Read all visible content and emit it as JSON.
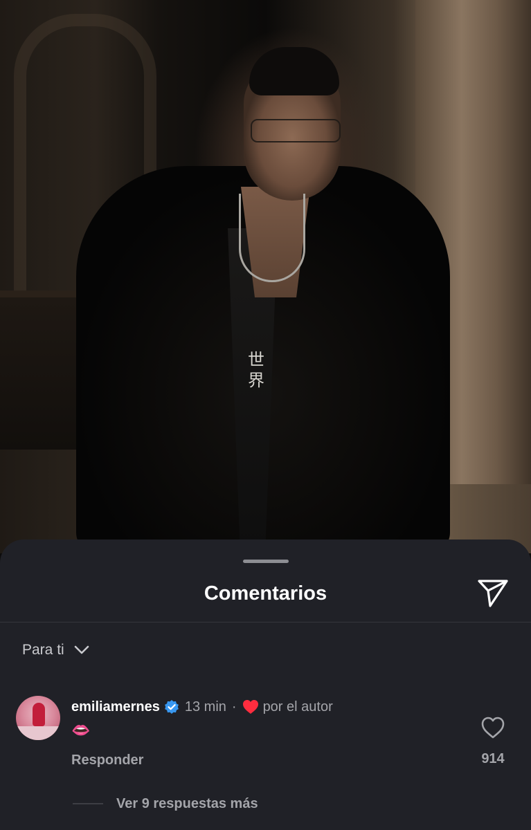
{
  "post": {
    "image": "photo of a man in a black fur coat inside a church",
    "shirt_glyphs": "世界",
    "colors": {
      "sheet_bg": "#202127",
      "muted_text": "#a4a5aa"
    }
  },
  "comments_sheet": {
    "title": "Comentarios",
    "share_icon": "paper-plane-icon",
    "filter": {
      "label": "Para ti",
      "icon": "chevron-down-icon"
    },
    "comments": [
      {
        "username": "emiliamernes",
        "verified": true,
        "time": "13 min",
        "separator": "·",
        "author_like_label": "por el autor",
        "author_like_icon": "red-heart-icon",
        "text": "👄",
        "reply_label": "Responder",
        "like_count": "914",
        "like_icon": "heart-outline-icon",
        "more_replies_label": "Ver 9 respuestas más"
      }
    ]
  }
}
